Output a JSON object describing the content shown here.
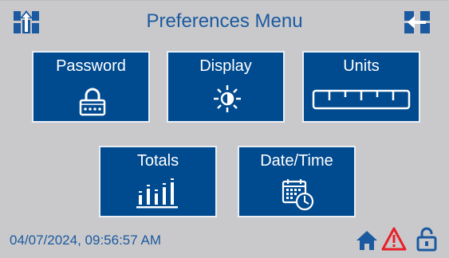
{
  "header": {
    "title": "Preferences Menu",
    "left_icon": "export-up-icon",
    "right_icon": "exit-arrow-icon"
  },
  "tiles": [
    {
      "label": "Password",
      "icon": "padlock-keypad-icon"
    },
    {
      "label": "Display",
      "icon": "brightness-icon"
    },
    {
      "label": "Units",
      "icon": "ruler-icon"
    },
    {
      "label": "Totals",
      "icon": "bar-totals-icon"
    },
    {
      "label": "Date/Time",
      "icon": "calendar-clock-icon"
    }
  ],
  "status": {
    "timestamp": "04/07/2024, 09:56:57 AM",
    "icons": [
      "home-icon",
      "warning-icon",
      "unlocked-icon"
    ],
    "warning_color": "#e8202a",
    "accent_color": "#1b5aa0"
  }
}
